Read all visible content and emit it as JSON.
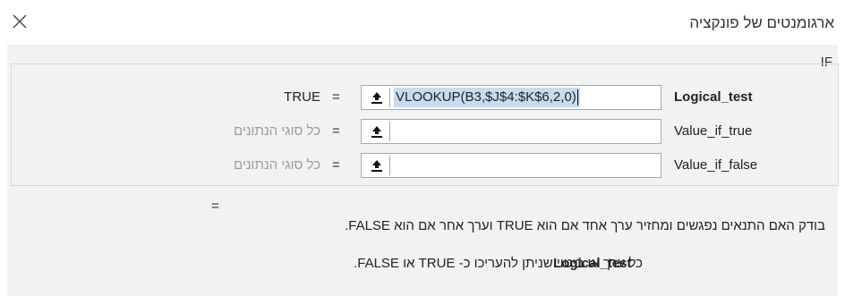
{
  "dialog": {
    "title": "ארגומנטים של פונקציה",
    "close_icon": "close-icon"
  },
  "function": {
    "name": "IF",
    "arguments": [
      {
        "name": "Logical_test",
        "value": "VLOOKUP(B3,$J$4:$K$6,2,0)",
        "result": "TRUE",
        "bold": true
      },
      {
        "name": "Value_if_true",
        "value": "",
        "result": "כל סוגי הנתונים",
        "bold": false
      },
      {
        "name": "Value_if_false",
        "value": "",
        "result": "כל סוגי הנתונים",
        "bold": false
      }
    ],
    "equals_sign": "=",
    "formula_result": "="
  },
  "help": {
    "description": "בודק האם התנאים נפגשים ומחזיר ערך אחד אם הוא TRUE וערך אחר אם הוא FALSE.",
    "argument_name": "Logical_test",
    "argument_description": "כל ערך או ביטוי שניתן להעריכו כ- TRUE או FALSE."
  },
  "icons": {
    "collapse": "collapse-dialog-icon"
  }
}
